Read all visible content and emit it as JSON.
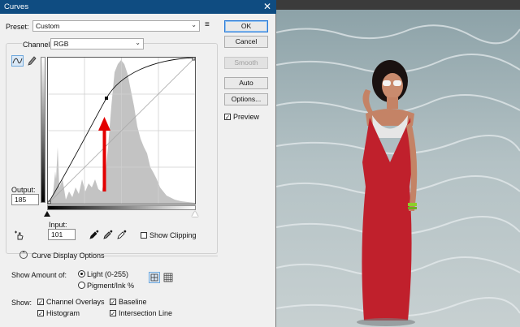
{
  "window": {
    "title": "Curves",
    "close_glyph": "✕"
  },
  "preset": {
    "label": "Preset:",
    "value": "Custom",
    "menu_glyph": "≡"
  },
  "channel": {
    "label": "Channel:",
    "value": "RGB"
  },
  "buttons": {
    "ok": "OK",
    "cancel": "Cancel",
    "smooth": "Smooth",
    "auto": "Auto",
    "options": "Options..."
  },
  "preview": {
    "label": "Preview",
    "checked": true
  },
  "output": {
    "label": "Output:",
    "value": "185"
  },
  "input": {
    "label": "Input:",
    "value": "101"
  },
  "show_clipping": {
    "label": "Show Clipping",
    "checked": false
  },
  "curve_display_options": {
    "label": "Curve Display Options"
  },
  "show_amount": {
    "label": "Show Amount of:",
    "light": "Light  (0-255)",
    "pigment": "Pigment/Ink %",
    "selected": "light"
  },
  "show": {
    "label": "Show:",
    "channel_overlays": "Channel Overlays",
    "baseline": "Baseline",
    "histogram": "Histogram",
    "intersection_line": "Intersection Line"
  },
  "curve": {
    "control_point": {
      "input": 101,
      "output": 185
    },
    "colors": {
      "arrow": "#e30000",
      "histogram": "#c3c3c3",
      "curve": "#111111"
    }
  },
  "photo": {
    "colors": {
      "dress": "#c0202c",
      "sea": "#8fa3a9",
      "sky_band": "#3b3b3b"
    }
  }
}
